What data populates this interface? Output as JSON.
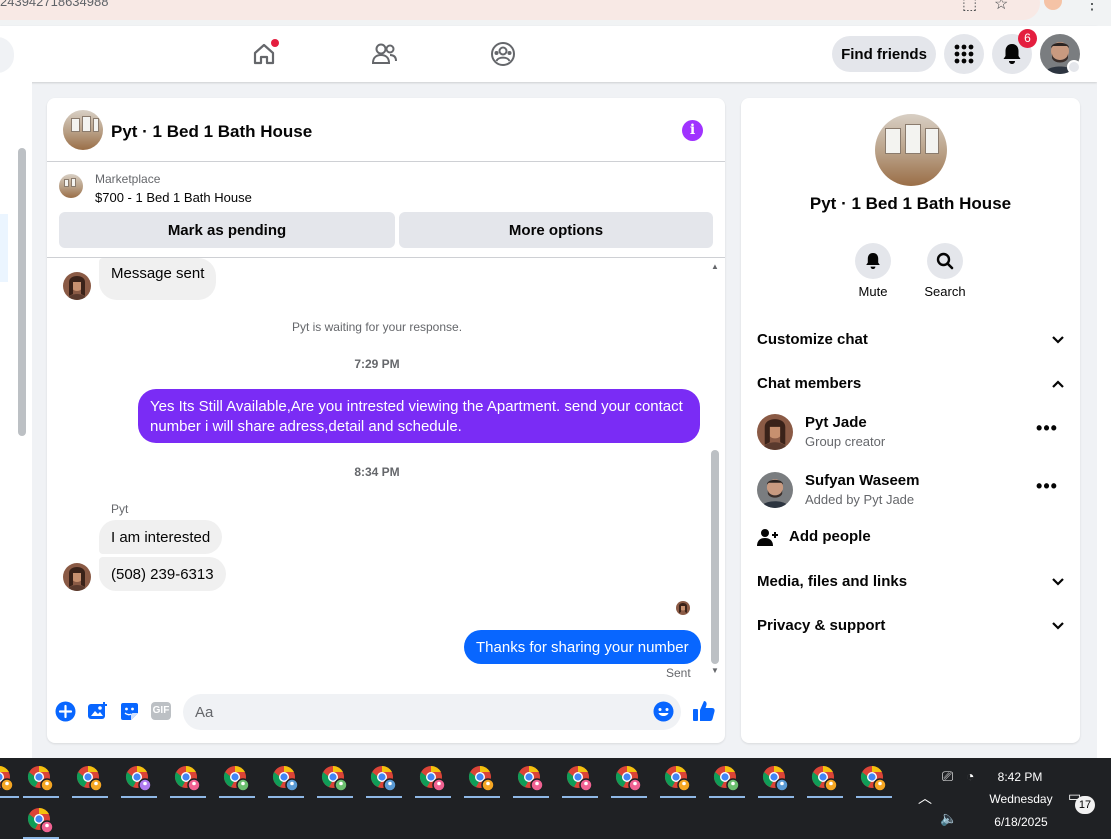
{
  "browser": {
    "url_fragment": "243942718634988"
  },
  "nav": {
    "find_friends": "Find friends",
    "notification_count": "6"
  },
  "chat": {
    "title": "Pyt · 1 Bed 1 Bath House",
    "marketplace": {
      "label": "Marketplace",
      "item": "$700 - 1 Bed 1 Bath House",
      "mark_pending": "Mark as pending",
      "more_options": "More options"
    },
    "messages": {
      "m1": "Message sent",
      "waiting": "Pyt is waiting for your response.",
      "time1": "7:29 PM",
      "m2_line1": "Yes Its Still Available,Are you intrested viewing the Apartment. send your contact",
      "m2_line2": "number i will share adress,detail and schedule.",
      "time2": "8:34 PM",
      "sender": "Pyt",
      "m3": "I am interested",
      "m4": "(508) 239-6313",
      "m5": "Thanks for sharing your number",
      "sent": "Sent"
    },
    "composer": {
      "placeholder": "Aa",
      "gif": "GIF"
    }
  },
  "info": {
    "title": "Pyt · 1 Bed 1 Bath House",
    "mute": "Mute",
    "search": "Search",
    "customize": "Customize chat",
    "members_header": "Chat members",
    "members": [
      {
        "name": "Pyt Jade",
        "role": "Group creator"
      },
      {
        "name": "Sufyan Waseem",
        "role": "Added by Pyt Jade"
      }
    ],
    "add_people": "Add people",
    "media": "Media, files and links",
    "privacy": "Privacy & support"
  },
  "taskbar": {
    "time": "8:42 PM",
    "day": "Wednesday",
    "date": "6/18/2025",
    "notif": "17"
  },
  "colors": {
    "fb_blue": "#0866ff",
    "purple_bubble": "#7a2cf5",
    "badge_red": "#e41e3f"
  }
}
